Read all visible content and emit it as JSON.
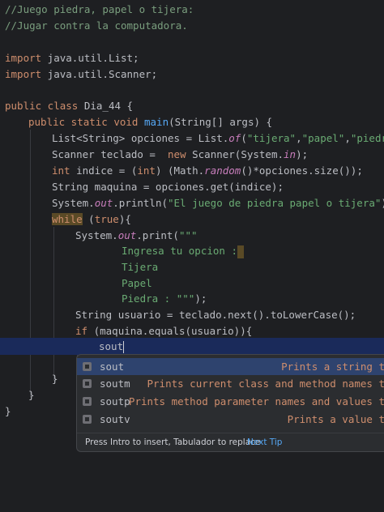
{
  "code": {
    "line1": "//Juego piedra, papel o tijera:",
    "line2": "//Jugar contra la computadora.",
    "imp1_kw": "import",
    "imp1_rest": " java.util.List;",
    "imp2_kw": "import",
    "imp2_rest": " java.util.Scanner;",
    "class_kw": "public class",
    "class_name": " Dia_44 {",
    "main_kw": "public static void",
    "main_name": " main",
    "main_rest": "(String[] args) {",
    "l1_a": "List<String> ",
    "l1_b": "opciones",
    "l1_c": " = List.",
    "l1_d": "of",
    "l1_e": "(",
    "l1_s1": "\"tijera\"",
    "l1_f": ",",
    "l1_s2": "\"papel\"",
    "l1_g": ",",
    "l1_s3": "\"piedra\"",
    "l2_a": "Scanner ",
    "l2_b": "teclado",
    "l2_c": " =  ",
    "l2_kw": "new",
    "l2_d": " Scanner(System.",
    "l2_e": "in",
    "l2_f": ");",
    "l3_kw": "int",
    "l3_b": " indice",
    "l3_c": " = (",
    "l3_kw2": "int",
    "l3_d": ") (Math.",
    "l3_e": "random",
    "l3_f": "()*opciones.size());",
    "l4": "String maquina = opciones.get(indice);",
    "l5_a": "System.",
    "l5_b": "out",
    "l5_c": ".println(",
    "l5_s": "\"El juego de piedra papel o tijera\"",
    "l5_d": ");",
    "l6_kw": "while",
    "l6_a": " (",
    "l6_kw2": "true",
    "l6_b": "){",
    "l7_a": "System.",
    "l7_b": "out",
    "l7_c": ".print(",
    "l7_s": "\"\"\"",
    "t1": "Ingresa tu opcion :",
    "t2": "Tijera",
    "t3": "Papel",
    "t4": "Piedra : \"\"\"",
    "t4_end": ");",
    "l8_a": "String ",
    "l8_b": "usuario",
    "l8_c": " = teclado.next().toLowerCase();",
    "l9_kw": "if",
    "l9_a": " (maquina.equals(usuario)){",
    "l10": "sout",
    "close1": "}",
    "close2": "}",
    "close3": "}"
  },
  "autocomplete": {
    "items": [
      {
        "name": "sout",
        "desc": "Prints a string t"
      },
      {
        "name": "soutm",
        "desc": "Prints current class and method names t"
      },
      {
        "name": "soutp",
        "desc": "Prints method parameter names and values t"
      },
      {
        "name": "soutv",
        "desc": "Prints a value t"
      }
    ],
    "footer_hint": "Press Intro to insert, Tabulador to replace",
    "footer_tip": "Next Tip"
  },
  "colors": {
    "background": "#1e1f22",
    "keyword": "#cf8e6d",
    "string": "#6aab73",
    "method": "#56a8f5",
    "selection": "#2e436e"
  }
}
